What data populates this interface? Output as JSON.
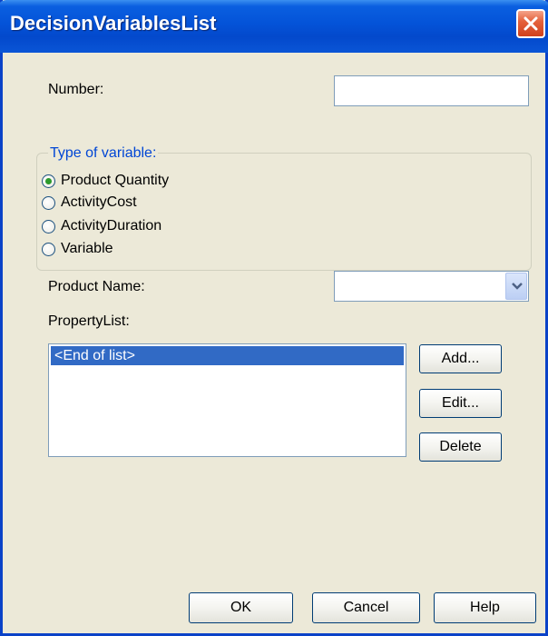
{
  "window": {
    "title": "DecisionVariablesList"
  },
  "form": {
    "number_label": "Number:",
    "number_value": "",
    "type_group_title": "Type of variable:",
    "radio_options": [
      {
        "label": "Product Quantity",
        "checked": true
      },
      {
        "label": "ActivityCost",
        "checked": false
      },
      {
        "label": "ActivityDuration",
        "checked": false
      },
      {
        "label": "Variable",
        "checked": false
      }
    ],
    "product_name_label": "Product Name:",
    "product_name_value": "",
    "property_list_label": "PropertyList:",
    "property_list_items": [
      "<End of list>"
    ]
  },
  "side_buttons": {
    "add": "Add...",
    "edit": "Edit...",
    "delete": "Delete"
  },
  "footer_buttons": {
    "ok": "OK",
    "cancel": "Cancel",
    "help": "Help"
  },
  "colors": {
    "titlebar": "#0453d8",
    "group_title": "#0046d5",
    "selection": "#316ac5",
    "close_button": "#e5633d",
    "dialog_bg": "#ece9d8"
  },
  "icons": {
    "close": "close-icon",
    "dropdown": "chevron-down-icon"
  }
}
